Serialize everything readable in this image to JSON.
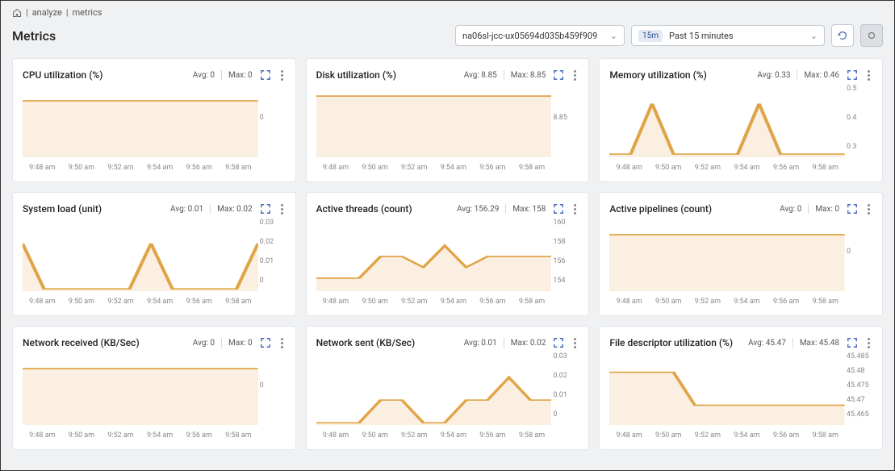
{
  "breadcrumb": {
    "sep1": "|",
    "analyze": "analyze",
    "sep2": "|",
    "metrics": "metrics"
  },
  "page_title": "Metrics",
  "controls": {
    "host": "na06sl-jcc-ux05694d035b459f909",
    "time_badge": "15m",
    "time_label": "Past 15 minutes"
  },
  "xticks": [
    "9:48 am",
    "9:50 am",
    "9:52 am",
    "9:54 am",
    "9:56 am",
    "9:58 am"
  ],
  "chart_data": [
    {
      "title": "CPU utilization (%)",
      "avg_label": "Avg: 0",
      "max_label": "Max: 0",
      "type": "area",
      "x": [
        0,
        1,
        2,
        3,
        4,
        5,
        6,
        7,
        8,
        9,
        10,
        11
      ],
      "values": [
        0,
        0,
        0,
        0,
        0,
        0,
        0,
        0,
        0,
        0,
        0,
        0
      ],
      "yticks": [
        "0"
      ],
      "ylim": [
        -0.35,
        0.1
      ]
    },
    {
      "title": "Disk utilization (%)",
      "avg_label": "Avg: 8.85",
      "max_label": "Max: 8.85",
      "type": "area",
      "x": [
        0,
        1,
        2,
        3,
        4,
        5,
        6,
        7,
        8,
        9,
        10,
        11
      ],
      "values": [
        8.85,
        8.85,
        8.85,
        8.85,
        8.85,
        8.85,
        8.85,
        8.85,
        8.85,
        8.85,
        8.85,
        8.85
      ],
      "yticks": [
        "8.85"
      ],
      "ylim": [
        0,
        10.5
      ]
    },
    {
      "title": "Memory utilization (%)",
      "avg_label": "Avg: 0.33",
      "max_label": "Max: 0.46",
      "type": "area",
      "x": [
        0,
        1,
        2,
        3,
        4,
        5,
        6,
        7,
        8,
        9,
        10,
        11
      ],
      "values": [
        0.3,
        0.3,
        0.46,
        0.3,
        0.3,
        0.3,
        0.3,
        0.46,
        0.3,
        0.3,
        0.3,
        0.3
      ],
      "yticks": [
        "0.5",
        "0.4",
        "0.3"
      ],
      "ylim": [
        0.29,
        0.52
      ]
    },
    {
      "title": "System load (unit)",
      "avg_label": "Avg: 0.01",
      "max_label": "Max: 0.02",
      "type": "area",
      "x": [
        0,
        1,
        2,
        3,
        4,
        5,
        6,
        7,
        8,
        9,
        10,
        11
      ],
      "values": [
        0.02,
        0,
        0,
        0,
        0,
        0,
        0.02,
        0,
        0,
        0,
        0,
        0.02
      ],
      "yticks": [
        "0.03",
        "0.02",
        "0.01",
        "0"
      ],
      "ylim": [
        -0.001,
        0.031
      ]
    },
    {
      "title": "Active threads (count)",
      "avg_label": "Avg: 156.29",
      "max_label": "Max: 158",
      "type": "area",
      "x": [
        0,
        1,
        2,
        3,
        4,
        5,
        6,
        7,
        8,
        9,
        10,
        11
      ],
      "values": [
        155,
        155,
        155,
        157,
        157,
        156,
        158,
        156,
        157,
        157,
        157,
        157
      ],
      "yticks": [
        "160",
        "158",
        "156",
        "154"
      ],
      "ylim": [
        153.8,
        160.5
      ]
    },
    {
      "title": "Active pipelines (count)",
      "avg_label": "Avg: 0",
      "max_label": "Max: 0",
      "type": "area",
      "x": [
        0,
        1,
        2,
        3,
        4,
        5,
        6,
        7,
        8,
        9,
        10,
        11
      ],
      "values": [
        0,
        0,
        0,
        0,
        0,
        0,
        0,
        0,
        0,
        0,
        0,
        0
      ],
      "yticks": [
        "0"
      ],
      "ylim": [
        -0.35,
        0.1
      ]
    },
    {
      "title": "Network received (KB/Sec)",
      "avg_label": "Avg: 0",
      "max_label": "Max: 0",
      "type": "area",
      "x": [
        0,
        1,
        2,
        3,
        4,
        5,
        6,
        7,
        8,
        9,
        10,
        11
      ],
      "values": [
        0,
        0,
        0,
        0,
        0,
        0,
        0,
        0,
        0,
        0,
        0,
        0
      ],
      "yticks": [
        "0"
      ],
      "ylim": [
        -0.35,
        0.1
      ]
    },
    {
      "title": "Network sent (KB/Sec)",
      "avg_label": "Avg: 0.01",
      "max_label": "Max: 0.02",
      "type": "area",
      "x": [
        0,
        1,
        2,
        3,
        4,
        5,
        6,
        7,
        8,
        9,
        10,
        11
      ],
      "values": [
        0,
        0,
        0,
        0.01,
        0.01,
        0,
        0,
        0.01,
        0.01,
        0.02,
        0.01,
        0.01
      ],
      "yticks": [
        "0.03",
        "0.02",
        "0.01",
        "0"
      ],
      "ylim": [
        -0.001,
        0.031
      ]
    },
    {
      "title": "File descriptor utilization (%)",
      "avg_label": "Avg: 45.47",
      "max_label": "Max: 45.48",
      "type": "area",
      "x": [
        0,
        1,
        2,
        3,
        4,
        5,
        6,
        7,
        8,
        9,
        10,
        11
      ],
      "values": [
        45.48,
        45.48,
        45.48,
        45.48,
        45.47,
        45.47,
        45.47,
        45.47,
        45.47,
        45.47,
        45.47,
        45.47
      ],
      "yticks": [
        "45.485",
        "45.48",
        "45.475",
        "45.47",
        "45.465"
      ],
      "ylim": [
        45.464,
        45.486
      ]
    }
  ]
}
